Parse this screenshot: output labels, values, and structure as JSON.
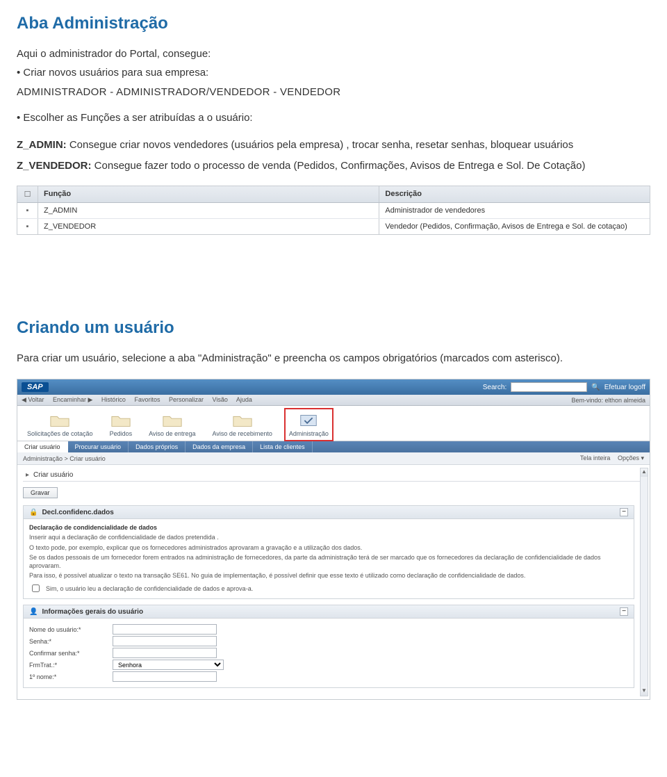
{
  "section1": {
    "title": "Aba Administração",
    "intro": "Aqui o administrador do Portal, consegue:",
    "bullet1_a": "• Criar novos usuários para sua empresa:",
    "bullet1_b": "ADMINISTRADOR  -  ADMINISTRADOR/VENDEDOR  -  VENDEDOR",
    "bullet2": "• Escolher as Funções a ser atribuídas a o usuário:",
    "z_admin_label": "Z_ADMIN:",
    "z_admin_text": " Consegue criar novos vendedores (usuários pela empresa) , trocar senha, resetar senhas, bloquear usuários",
    "z_vendedor_label": "Z_VENDEDOR:",
    "z_vendedor_text": " Consegue fazer todo o processo de venda (Pedidos, Confirmações, Avisos de Entrega e Sol. De Cotação)"
  },
  "sap_table": {
    "col1": "Função",
    "col2": "Descrição",
    "rows": [
      {
        "func": "Z_ADMIN",
        "desc": "Administrador de vendedores"
      },
      {
        "func": "Z_VENDEDOR",
        "desc": "Vendedor (Pedidos, Confirmação, Avisos de Entrega e Sol. de cotaçao)"
      }
    ]
  },
  "section2": {
    "title": "Criando um usuário",
    "text": "Para criar um usuário, selecione a aba \"Administração\" e preencha os campos obrigatórios (marcados com asterisco)."
  },
  "portal": {
    "logo": "SAP",
    "search_label": "Search:",
    "search_placeholder": "",
    "logoff": "Efetuar logoff",
    "welcome": "Bem-vindo: elthon almeida",
    "nav_items": [
      "◀ Voltar",
      "Encaminhar ▶",
      "Histórico",
      "Favoritos",
      "Personalizar",
      "Visão",
      "Ajuda"
    ],
    "main_tabs": [
      "Solicitações de cotação",
      "Pedidos",
      "Aviso de entrega",
      "Aviso de recebimento",
      "Administração"
    ],
    "sub_tabs": [
      "Criar usuário",
      "Procurar usuário",
      "Dados próprios",
      "Dados da empresa",
      "Lista de clientes"
    ],
    "breadcrumb": "Administração  >  Criar usuário",
    "tela_inteira": "Tela inteira",
    "opcoes": "Opções ▾",
    "accordion_title": "Criar usuário",
    "btn_gravar": "Gravar",
    "panel1": {
      "title": "Decl.confidenc.dados",
      "p_bold": "Declaração de condidencialidade de dados",
      "p1": "Inserir aqui a declaração de confidencialidade de dados pretendida .",
      "p2": "O texto pode, por exemplo, explicar que os fornecedores administrados aprovaram a gravação e a utilização dos dados.",
      "p3": "Se os dados pessoais de um fornecedor forem entrados na administração de fornecedores, da parte da administração terá de ser marcado que os fornecedores da declaração de confidencialidade de dados aprovaram.",
      "p4": "Para isso, é possível atualizar o texto na transação SE61. No guia de implementação, é possível definir que esse texto é utilizado como declaração de confidencialidade de dados.",
      "checkbox": "Sim, o usuário leu a declaração de confidencialidade de dados e aprova-a."
    },
    "panel2": {
      "title": "Informações gerais do usuário",
      "fields": {
        "nome": "Nome do usuário:*",
        "senha": "Senha:*",
        "confirmar": "Confirmar senha:*",
        "frmtrat": "FrmTrat.:*",
        "frmtrat_value": "Senhora",
        "primeiro_nome": "1º nome:*"
      }
    }
  }
}
